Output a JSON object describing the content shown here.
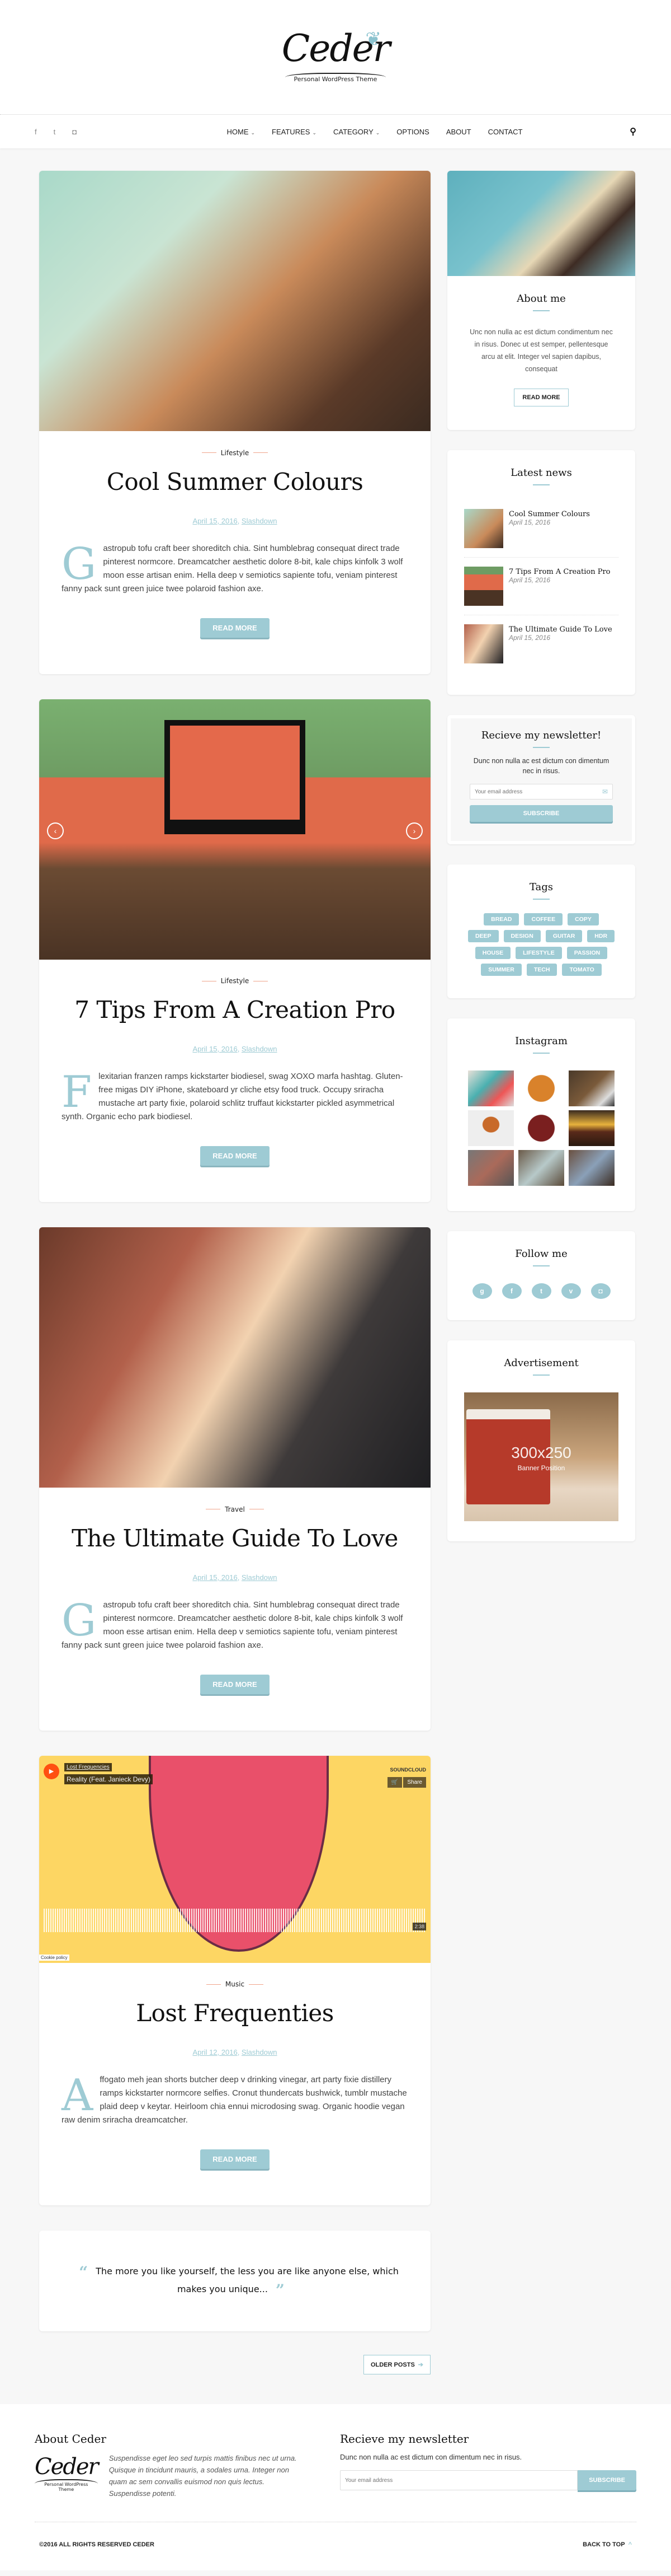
{
  "header": {
    "logo_text": "Ceder",
    "logo_tagline": "Personal WordPress Theme"
  },
  "nav": {
    "social": [
      {
        "icon": "facebook-icon",
        "glyph": "f"
      },
      {
        "icon": "twitter-icon",
        "glyph": "t"
      },
      {
        "icon": "instagram-icon",
        "glyph": "◘"
      }
    ],
    "items": [
      {
        "label": "HOME",
        "dropdown": true
      },
      {
        "label": "FEATURES",
        "dropdown": true
      },
      {
        "label": "CATEGORY",
        "dropdown": true
      },
      {
        "label": "OPTIONS",
        "dropdown": false
      },
      {
        "label": "ABOUT",
        "dropdown": false
      },
      {
        "label": "CONTACT",
        "dropdown": false
      }
    ],
    "search_icon": "search-icon"
  },
  "posts": [
    {
      "category": "Lifestyle",
      "title": "Cool Summer Colours",
      "date": "April 15, 2016",
      "author": "Slashdown",
      "dropcap": "G",
      "excerpt": "astropub tofu craft beer shoreditch chia. Sint humblebrag consequat direct trade pinterest normcore. Dreamcatcher aesthetic dolore 8-bit, kale chips kinfolk 3 wolf moon esse artisan enim. Hella deep v semiotics sapiente tofu, veniam pinterest fanny pack sunt green juice twee polaroid fashion axe.",
      "button": "READ MORE"
    },
    {
      "category": "Lifestyle",
      "title": "7 Tips From A Creation Pro",
      "date": "April 15, 2016",
      "author": "Slashdown",
      "dropcap": "F",
      "excerpt": "lexitarian franzen ramps kickstarter biodiesel, swag XOXO marfa hashtag. Gluten-free migas DIY iPhone, skateboard yr cliche etsy food truck. Occupy sriracha mustache art party fixie, polaroid schlitz truffaut kickstarter pickled asymmetrical synth. Organic echo park biodiesel.",
      "button": "READ MORE",
      "slider_prev": "‹",
      "slider_next": "›"
    },
    {
      "category": "Travel",
      "title": "The Ultimate Guide To Love",
      "date": "April 15, 2016",
      "author": "Slashdown",
      "dropcap": "G",
      "excerpt": "astropub tofu craft beer shoreditch chia. Sint humblebrag consequat direct trade pinterest normcore. Dreamcatcher aesthetic dolore 8-bit, kale chips kinfolk 3 wolf moon esse artisan enim. Hella deep v semiotics sapiente tofu, veniam pinterest fanny pack sunt green juice twee polaroid fashion axe.",
      "button": "READ MORE"
    },
    {
      "category": "Music",
      "title": "Lost Frequenties",
      "date": "April 12, 2016",
      "author": "Slashdown",
      "dropcap": "A",
      "excerpt": "ffogato meh jean shorts butcher deep v drinking vinegar, art party fixie distillery ramps kickstarter normcore selfies. Cronut thundercats bushwick, tumblr mustache plaid deep v keytar. Heirloom chia ennui microdosing swag. Organic hoodie vegan raw denim sriracha dreamcatcher.",
      "button": "READ MORE",
      "player": {
        "artist": "Lost Frequencies",
        "track": "Reality (Feat. Janieck Devy)",
        "brand": "SOUNDCLOUD",
        "cart": "🛒",
        "share": "Share",
        "duration": "2:38",
        "cookie": "Cookie policy"
      }
    }
  ],
  "quote": {
    "text": "The more you like yourself, the less you are like anyone else, which makes you unique...",
    "open": "“",
    "close": "”"
  },
  "pagination": {
    "older_label": "OLDER POSTS",
    "arrow": "➔"
  },
  "sidebar": {
    "about": {
      "title": "About me",
      "text": "Unc non nulla ac est dictum condimentum nec in risus. Donec ut est semper, pellentesque arcu at elit. Integer vel sapien dapibus, consequat",
      "button": "READ MORE"
    },
    "latest": {
      "title": "Latest news",
      "items": [
        {
          "title": "Cool Summer Colours",
          "date": "April 15, 2016"
        },
        {
          "title": "7 Tips From A Creation Pro",
          "date": "April 15, 2016"
        },
        {
          "title": "The Ultimate Guide To Love",
          "date": "April 15, 2016"
        }
      ]
    },
    "newsletter": {
      "title": "Recieve my newsletter!",
      "desc": "Dunc non nulla ac est dictum con dimentum nec in risus.",
      "placeholder": "Your email address",
      "button": "SUBSCRIBE"
    },
    "tags": {
      "title": "Tags",
      "items": [
        "BREAD",
        "COFFEE",
        "COPY",
        "DEEP",
        "DESIGN",
        "GUITAR",
        "HDR",
        "HOUSE",
        "LIFESTYLE",
        "PASSION",
        "SUMMER",
        "TECH",
        "TOMATO"
      ]
    },
    "instagram": {
      "title": "Instagram"
    },
    "follow": {
      "title": "Follow me",
      "items": [
        {
          "icon": "google-plus-icon",
          "glyph": "g"
        },
        {
          "icon": "facebook-icon",
          "glyph": "f"
        },
        {
          "icon": "twitter-icon",
          "glyph": "t"
        },
        {
          "icon": "vimeo-icon",
          "glyph": "v"
        },
        {
          "icon": "instagram-icon",
          "glyph": "◘"
        }
      ]
    },
    "ad": {
      "title": "Advertisement",
      "size": "300x250",
      "sub": "Banner Position"
    }
  },
  "footer": {
    "about_title": "About Ceder",
    "about_text": "Suspendisse eget leo sed turpis mattis finibus nec ut urna. Quisque in tincidunt mauris, a sodales urna. Integer non quam ac sem convallis euismod non quis lectus. Suspendisse potenti.",
    "newsletter_title": "Recieve my newsletter",
    "newsletter_desc": "Dunc non nulla ac est dictum con dimentum nec in risus.",
    "placeholder": "Your email address",
    "subscribe": "SUBSCRIBE",
    "copyright": "©2016 ALL RIGHTS RESERVED CEDER",
    "back_to_top": "BACK TO TOP",
    "up_arrow": "^"
  },
  "colors": {
    "accent": "#9ecbd4",
    "category_line": "#f0a58c",
    "background": "#f7f7f7"
  }
}
